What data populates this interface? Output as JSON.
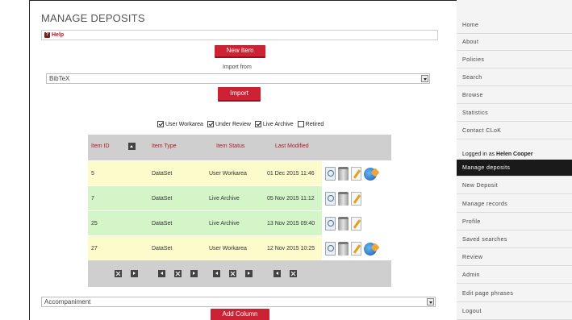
{
  "page": {
    "title": "MANAGE DEPOSITS",
    "help_label": "Help"
  },
  "actions": {
    "new_item_label": "New Item",
    "import_from_label": "Import from",
    "import_format": "BibTeX",
    "import_label": "Import"
  },
  "filters": [
    {
      "label": "User Workarea",
      "checked": true
    },
    {
      "label": "Under Review",
      "checked": true
    },
    {
      "label": "Live Archive",
      "checked": true
    },
    {
      "label": "Retired",
      "checked": false
    }
  ],
  "table": {
    "columns": [
      "Item ID",
      "Item Type",
      "Item Status",
      "Last Modified"
    ],
    "rows": [
      {
        "id": "5",
        "type": "DataSet",
        "status": "User Workarea",
        "modified": "01 Dec 2015 11:46",
        "publishable": true
      },
      {
        "id": "7",
        "type": "DataSet",
        "status": "Live Archive",
        "modified": "05 Nov 2015 11:12",
        "publishable": false
      },
      {
        "id": "25",
        "type": "DataSet",
        "status": "Live Archive",
        "modified": "13 Nov 2015 09:40",
        "publishable": false
      },
      {
        "id": "27",
        "type": "DataSet",
        "status": "User Workarea",
        "modified": "12 Nov 2015 10:25",
        "publishable": true
      }
    ],
    "row_colors": {
      "User Workarea": "#fbfbcc",
      "Live Archive": "#d3f5c8"
    }
  },
  "column_select": {
    "value": "Accompaniment",
    "add_label": "Add Column"
  },
  "sidebar": {
    "items_top": [
      "Home",
      "About",
      "Policies",
      "Search",
      "Browse",
      "Statistics",
      "Contact CLoK"
    ],
    "logged_in_prefix": "Logged in as",
    "logged_in_user": "Helen Cooper",
    "items_user": [
      "Manage deposits",
      "New Deposit",
      "Manage records",
      "Profile",
      "Saved searches",
      "Review",
      "Admin",
      "Edit page phrases",
      "Logout"
    ],
    "active": "Manage deposits"
  },
  "colors": {
    "accent": "#cc2233",
    "header_text": "#b01a2a"
  }
}
